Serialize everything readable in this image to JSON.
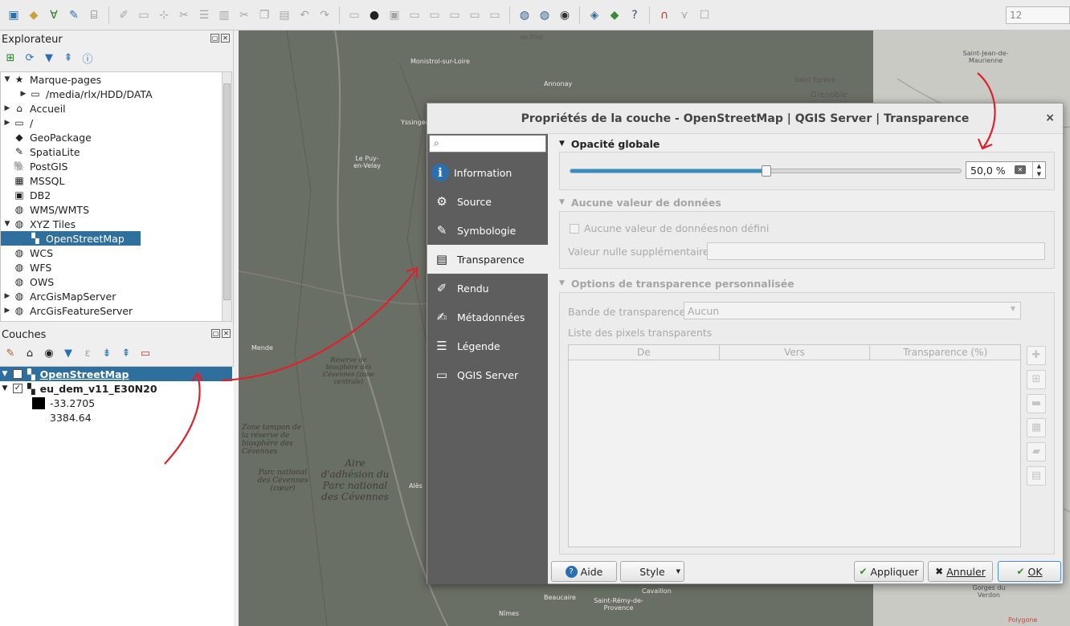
{
  "toolbar": {
    "icons": [
      "new-project-icon",
      "open-project-icon",
      "digitize-icon",
      "edit-pencil-icon",
      "gps-icon",
      "toggle-edit-icon",
      "save-layer-icon",
      "add-feature-icon",
      "vertex-tool-icon",
      "attribute-icon",
      "delete-icon",
      "cut-icon",
      "copy-icon",
      "paste-icon",
      "undo-icon",
      "redo-icon",
      "label-icon",
      "label-pin-icon",
      "label-highlight-icon",
      "label-move-icon",
      "label-rotate-icon",
      "label-change-icon",
      "label-show-icon",
      "label-properties-icon",
      "globe-grid-icon",
      "globe-search-icon",
      "mustache-icon",
      "python-icon",
      "plugin-icon",
      "help-icon",
      "magnet-icon",
      "snap-tolerance-icon",
      "checkbox-icon"
    ],
    "scale_value": "12"
  },
  "browser": {
    "title": "Explorateur",
    "items": [
      {
        "label": "Marque-pages",
        "arrow": "▼",
        "icon": "★",
        "indent": 0
      },
      {
        "label": "/media/rlx/HDD/DATA",
        "arrow": "▶",
        "icon": "▭",
        "indent": 1
      },
      {
        "label": "Accueil",
        "arrow": "▶",
        "icon": "⌂",
        "indent": 0
      },
      {
        "label": "/",
        "arrow": "▶",
        "icon": "▭",
        "indent": 0
      },
      {
        "label": "GeoPackage",
        "arrow": "",
        "icon": "◆",
        "indent": 0
      },
      {
        "label": "SpatiaLite",
        "arrow": "",
        "icon": "✎",
        "indent": 0
      },
      {
        "label": "PostGIS",
        "arrow": "",
        "icon": "🐘",
        "indent": 0
      },
      {
        "label": "MSSQL",
        "arrow": "",
        "icon": "▦",
        "indent": 0
      },
      {
        "label": "DB2",
        "arrow": "",
        "icon": "▣",
        "indent": 0
      },
      {
        "label": "WMS/WMTS",
        "arrow": "",
        "icon": "◍",
        "indent": 0
      },
      {
        "label": "XYZ Tiles",
        "arrow": "▼",
        "icon": "◍",
        "indent": 0
      },
      {
        "label": "OpenStreetMap",
        "arrow": "",
        "icon": "▚",
        "indent": 1,
        "selected": true
      },
      {
        "label": "WCS",
        "arrow": "",
        "icon": "◍",
        "indent": 0
      },
      {
        "label": "WFS",
        "arrow": "",
        "icon": "◍",
        "indent": 0
      },
      {
        "label": "OWS",
        "arrow": "",
        "icon": "◍",
        "indent": 0
      },
      {
        "label": "ArcGisMapServer",
        "arrow": "▶",
        "icon": "◍",
        "indent": 0
      },
      {
        "label": "ArcGisFeatureServer",
        "arrow": "▶",
        "icon": "◍",
        "indent": 0
      }
    ]
  },
  "layers": {
    "title": "Couches",
    "items": [
      {
        "name": "OpenStreetMap",
        "checked": true,
        "selected": true
      },
      {
        "name": "eu_dem_v11_E30N20",
        "checked": true,
        "selected": false
      }
    ],
    "legend_min": "-33.2705",
    "legend_max": "3384.64"
  },
  "map": {
    "labels": [
      {
        "text": "de Pilat",
        "cls": "dark"
      },
      {
        "text": "Monistrol-sur-Loire",
        "cls": "town"
      },
      {
        "text": "Annonay",
        "cls": "town"
      },
      {
        "text": "Saint-Jean-de-Maurienne",
        "cls": "dark"
      },
      {
        "text": "Saint Egrève",
        "cls": "dark"
      },
      {
        "text": "Grenoble",
        "cls": "dark"
      },
      {
        "text": "Yssingeaux",
        "cls": "town"
      },
      {
        "text": "Le Puy-en-Velay",
        "cls": "town"
      },
      {
        "text": "Mende",
        "cls": "town"
      },
      {
        "text": "Réserve de biosphère des Cévennes (zone centrale)",
        "cls": ""
      },
      {
        "text": "Zone tampon de la réserve de biosphère des Cévennes",
        "cls": ""
      },
      {
        "text": "Aire d'adhésion du Parc national des Cévennes",
        "cls": ""
      },
      {
        "text": "Parc national des Cévennes (cœur)",
        "cls": ""
      },
      {
        "text": "Alès",
        "cls": "town"
      },
      {
        "text": "Nîmes",
        "cls": "town"
      },
      {
        "text": "Beaucaire",
        "cls": "town"
      },
      {
        "text": "Saint-Rémy-de-Provence",
        "cls": "town"
      },
      {
        "text": "Cavaillon",
        "cls": "town"
      },
      {
        "text": "Gorges du Verdon",
        "cls": "dark"
      },
      {
        "text": "Polygone",
        "cls": "dark"
      }
    ]
  },
  "dialog": {
    "title": "Propriétés de la couche - OpenStreetMap | QGIS Server | Transparence",
    "close": "×",
    "search_placeholder": "",
    "nav": [
      {
        "label": "Information",
        "icon": "ℹ",
        "active": false
      },
      {
        "label": "Source",
        "icon": "⚙",
        "active": false
      },
      {
        "label": "Symbologie",
        "icon": "✎",
        "active": false
      },
      {
        "label": "Transparence",
        "icon": "▤",
        "active": true
      },
      {
        "label": "Rendu",
        "icon": "✐",
        "active": false
      },
      {
        "label": "Métadonnées",
        "icon": "✍",
        "active": false
      },
      {
        "label": "Légende",
        "icon": "☰",
        "active": false
      },
      {
        "label": "QGIS Server",
        "icon": "▭",
        "active": false
      }
    ],
    "opacity": {
      "header": "Opacité globale",
      "value": 0.5,
      "display": "50,0 %"
    },
    "nodata": {
      "header": "Aucune valeur de données",
      "checkbox_label": "Aucune valeur de données",
      "checkbox_value": "non défini",
      "extra_label": "Valeur nulle supplémentaire",
      "extra_value": ""
    },
    "custom": {
      "header": "Options de transparence personnalisée",
      "band_label": "Bande de transparence",
      "band_value": "Aucun",
      "pixels_label": "Liste des pixels transparents",
      "columns": [
        "De",
        "Vers",
        "Transparence (%)"
      ]
    },
    "buttons": {
      "help": "Aide",
      "style": "Style",
      "apply": "Appliquer",
      "cancel": "Annuler",
      "ok": "OK"
    }
  },
  "colors": {
    "selection": "#2e6f9e",
    "slider_fill": "#2a8fca",
    "annotation": "#e0202a",
    "sidebar": "#5e5e5e"
  }
}
